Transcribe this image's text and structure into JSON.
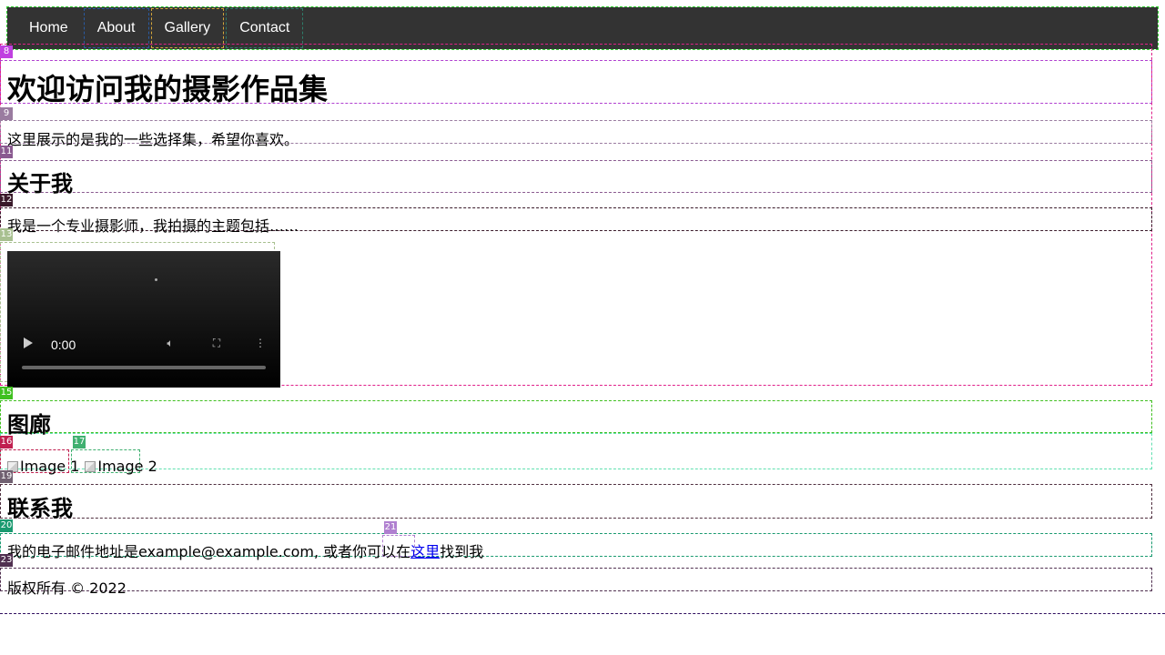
{
  "nav": {
    "items": [
      {
        "label": "Home"
      },
      {
        "label": "About"
      },
      {
        "label": "Gallery"
      },
      {
        "label": "Contact"
      }
    ]
  },
  "hero": {
    "title": "欢迎访问我的摄影作品集",
    "subtitle": "这里展示的是我的一些选择集，希望你喜欢。"
  },
  "about": {
    "heading": "关于我",
    "text": "我是一个专业摄影师，我拍摄的主题包括……"
  },
  "video": {
    "time": "0:00"
  },
  "gallery": {
    "heading": "图廊",
    "images": [
      {
        "alt": "Image 1"
      },
      {
        "alt": "Image 2"
      }
    ]
  },
  "contact": {
    "heading": "联系我",
    "text_before": "我的电子邮件地址是example@example.com, 或者你可以在",
    "link": "这里",
    "text_after": "找到我"
  },
  "footer": {
    "copyright": "版权所有 © 2022"
  },
  "debug_tags": {
    "t8": "8",
    "t9": "9",
    "t11": "11",
    "t12": "12",
    "t13": "13",
    "t15": "15",
    "t16": "16",
    "t17": "17",
    "t19": "19",
    "t20": "20",
    "t21": "21",
    "t23": "23"
  },
  "colors": {
    "nav_bg": "#333333",
    "link": "#0000ee"
  }
}
